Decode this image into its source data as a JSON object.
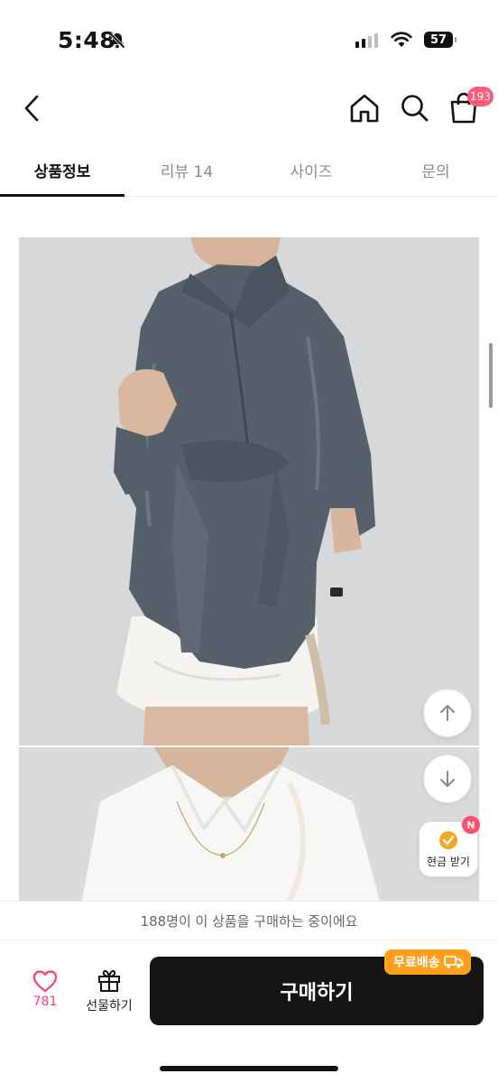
{
  "status_bar": {
    "time": "5:48",
    "battery": "57"
  },
  "header": {
    "cart_badge": "193"
  },
  "tabs": [
    {
      "label": "상품정보",
      "active": true
    },
    {
      "label": "리뷰 14",
      "active": false
    },
    {
      "label": "사이즈",
      "active": false
    },
    {
      "label": "문의",
      "active": false
    }
  ],
  "floating": {
    "cash_label": "현금 받기",
    "cash_badge": "N"
  },
  "purchase_info": {
    "buyers_text": "188명이 이 상품을 구매하는 중이에요"
  },
  "bottom_bar": {
    "like_count": "781",
    "gift_label": "선물하기",
    "buy_label": "구매하기",
    "free_shipping": "무료배송"
  },
  "colors": {
    "accent_pink": "#ff3d6a",
    "badge_pink": "#ff5a7a",
    "shipping_orange": "#ff9f1c",
    "buy_button": "#151515"
  }
}
